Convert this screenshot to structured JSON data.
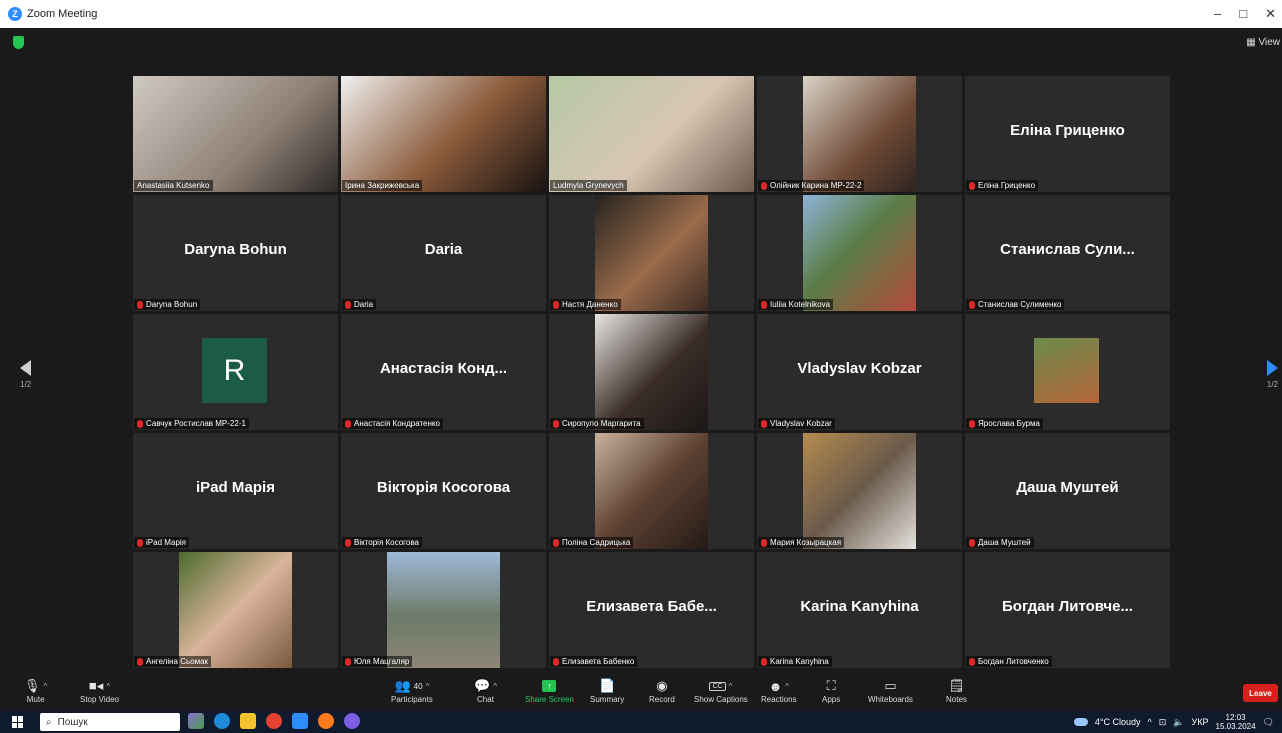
{
  "window": {
    "title": "Zoom Meeting",
    "view_label": "View",
    "controls": [
      "–",
      "□",
      "✕"
    ]
  },
  "tiles": [
    {
      "name": "Anastasiia Kutsenko",
      "mode": "video",
      "muted": false,
      "bg": "linear-gradient(135deg,#cfcac4,#8d7f74 60%,#2e2a28)"
    },
    {
      "name": "Ірина Закрижевська",
      "mode": "video",
      "muted": false,
      "bg": "linear-gradient(135deg,#f0f0ef,#8a5a3a 55%,#191413)"
    },
    {
      "name": "Ludmyla Grynevych",
      "mode": "video",
      "muted": false,
      "active": true,
      "bg": "linear-gradient(135deg,#b6c9a4,#d8c6b4 55%,#6d5a4c)"
    },
    {
      "name": "Олійник Карина МР-22-2",
      "mode": "video-mid",
      "muted": true,
      "bg": "linear-gradient(135deg,#d9d2c6,#6f4a36 60%,#2d2420)"
    },
    {
      "name": "Еліна Гриценко",
      "mode": "name",
      "display": "Еліна Гриценко",
      "muted": true
    },
    {
      "name": "Daryna Bohun",
      "mode": "name",
      "display": "Daryna Bohun",
      "muted": true
    },
    {
      "name": "Daria",
      "mode": "name",
      "display": "Daria",
      "muted": true
    },
    {
      "name": "Настя Даненко",
      "mode": "video-mid",
      "muted": true,
      "bg": "linear-gradient(135deg,#25231f,#9a6b4c 55%,#3c2a22)"
    },
    {
      "name": "Iuliia Kotelnikova",
      "mode": "video-mid",
      "muted": true,
      "bg": "linear-gradient(135deg,#8eb3d7,#5b7d46 45%,#b44a3f)"
    },
    {
      "name": "Станислав Сулименко",
      "mode": "name",
      "display": "Станислав Сули...",
      "muted": true
    },
    {
      "name": "Савчук Ростислав МР-22-1",
      "mode": "avatar",
      "avatar_letter": "R",
      "muted": true
    },
    {
      "name": "Анастасія Кондратенко",
      "mode": "name",
      "display": "Анастасія Конд...",
      "muted": true
    },
    {
      "name": "Сиропуло Маргарита",
      "mode": "video-mid",
      "muted": true,
      "bg": "linear-gradient(135deg,#e8e6e2,#3a2d28 55%,#1b1716)"
    },
    {
      "name": "Vladyslav Kobzar",
      "mode": "name",
      "display": "Vladyslav Kobzar",
      "muted": true
    },
    {
      "name": "Ярослава Бурма",
      "mode": "thumb",
      "muted": true
    },
    {
      "name": "iPad Марія",
      "mode": "name",
      "display": "iPad Марія",
      "muted": true
    },
    {
      "name": "Вікторія Косогова",
      "mode": "name",
      "display": "Вікторія Косогова",
      "muted": true
    },
    {
      "name": "Поліна Садрицька",
      "mode": "video-mid",
      "muted": true,
      "bg": "linear-gradient(135deg,#c9b29c,#5e4234 50%,#241a16)"
    },
    {
      "name": "Мария Козырацкая",
      "mode": "video-mid",
      "muted": true,
      "bg": "linear-gradient(135deg,#b58a4e,#6b5b4c 50%,#e5e2de)"
    },
    {
      "name": "Даша Муштей",
      "mode": "name",
      "display": "Даша Муштей",
      "muted": true
    },
    {
      "name": "Ангеліна Сьомак",
      "mode": "video-mid",
      "muted": true,
      "bg": "linear-gradient(135deg,#4d6b2f,#d8b49a 50%,#7b5a3f)"
    },
    {
      "name": "Юля Мацгаляр",
      "mode": "video-mid",
      "muted": true,
      "bg": "linear-gradient(180deg,#9fb9d8,#6e7b6a 55%,#8c8578)"
    },
    {
      "name": "Елизавета Бабенко",
      "mode": "name",
      "display": "Елизавета Бабе...",
      "muted": true
    },
    {
      "name": "Karina Kanyhina",
      "mode": "name",
      "display": "Karina Kanyhina",
      "muted": true
    },
    {
      "name": "Богдан Литовченко",
      "mode": "name",
      "display": "Богдан Литовче...",
      "muted": true
    }
  ],
  "pager": {
    "left": "1/2",
    "right": "1/2"
  },
  "toolbar": {
    "mute": "Mute",
    "stop_video": "Stop Video",
    "participants": "Participants",
    "participants_count": "40",
    "chat": "Chat",
    "share_screen": "Share Screen",
    "summary": "Summary",
    "record": "Record",
    "show_captions": "Show Captions",
    "reactions": "Reactions",
    "apps": "Apps",
    "whiteboards": "Whiteboards",
    "notes": "Notes",
    "leave": "Leave"
  },
  "taskbar": {
    "search_placeholder": "Пошук",
    "weather": "4°C Cloudy",
    "lang": "УКР",
    "time": "12:03",
    "date": "15.03.2024"
  }
}
